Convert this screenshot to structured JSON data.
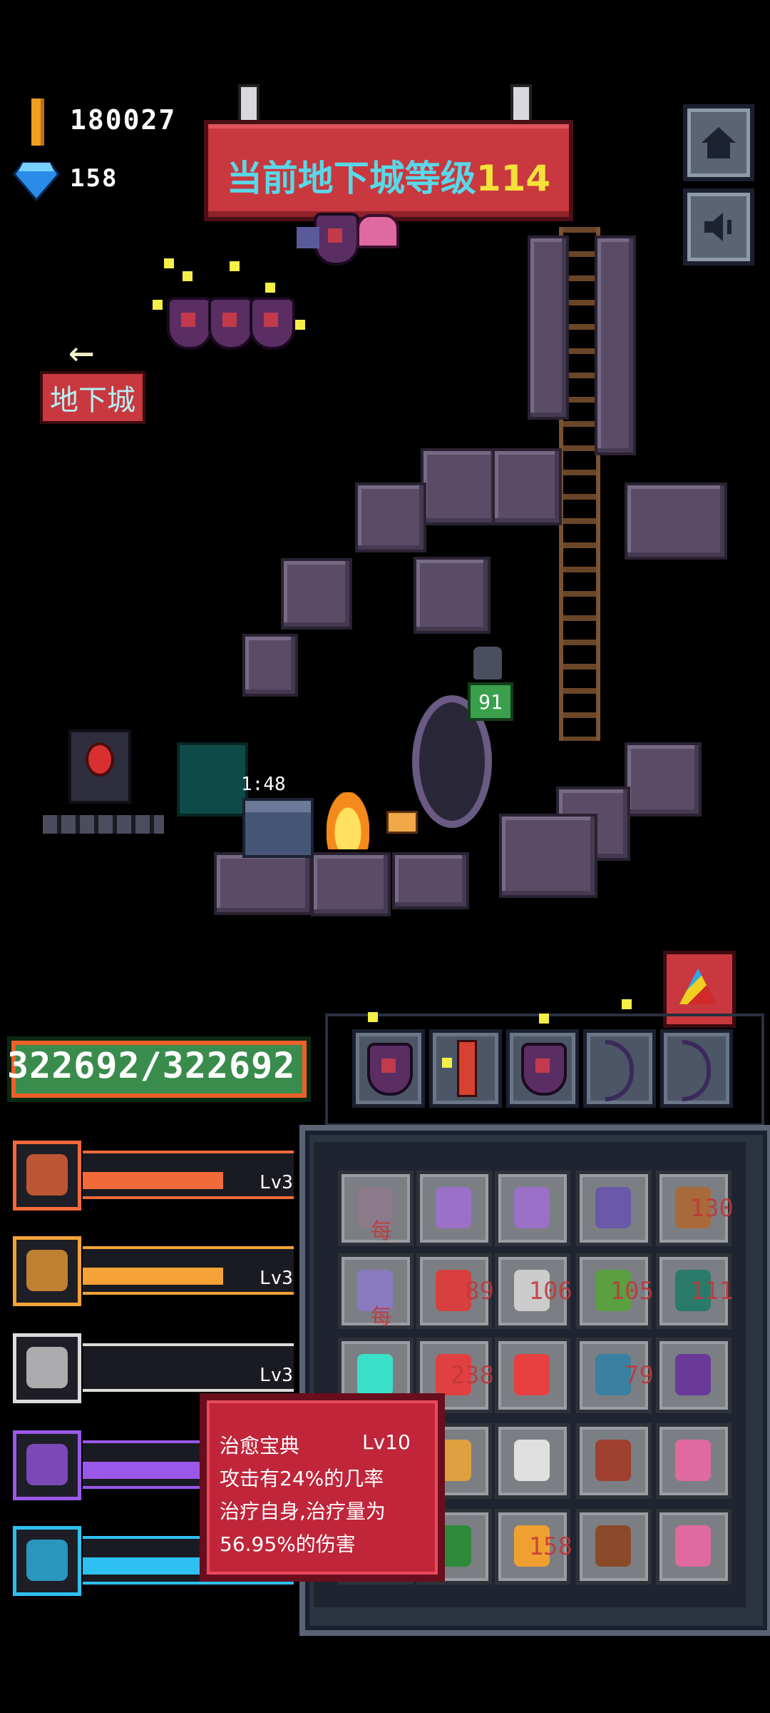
{
  "currency": {
    "gold": "180027",
    "gems": "158"
  },
  "banner": {
    "label": "当前地下城等级",
    "level": "114"
  },
  "nav": {
    "back_arrow": "←",
    "dungeon_label": "地下城",
    "home_icon": "house-icon",
    "sound_icon": "speaker-icon"
  },
  "scene": {
    "timer": "1:48",
    "npc_level": "91"
  },
  "hero": {
    "hp": "322692/322692"
  },
  "skills": [
    {
      "name": "helmet",
      "level": "Lv3",
      "fill": 0.82,
      "color": "#f26a3a"
    },
    {
      "name": "crossed-swords",
      "level": "Lv3",
      "fill": 0.82,
      "color": "#f5a236"
    },
    {
      "name": "boot",
      "level": "Lv3",
      "fill": 0.0,
      "color": "#dcdcdc"
    },
    {
      "name": "wand",
      "level": "",
      "fill": 0.75,
      "color": "#9a58e8"
    },
    {
      "name": "bow-arrows",
      "level": "",
      "fill": 0.75,
      "color": "#2ec0f0"
    }
  ],
  "inventory": {
    "counts": {
      "r0c4": "130",
      "r1c1": "89",
      "r1c2": "106",
      "r1c3": "105",
      "r1c4": "111",
      "r2c1": "238",
      "r2c3": "79",
      "r4c2": "158"
    },
    "faint_label": "每"
  },
  "tooltip": {
    "title": "治愈宝典",
    "level": "Lv10",
    "line1": "攻击有24%的几率",
    "line2": "治疗自身,治疗量为",
    "line3": "56.95%的伤害"
  },
  "colors": {
    "banner": "#c8383e",
    "banner_text": "#59d8e8",
    "banner_level": "#f4e23a",
    "hp": "#3a8c4c",
    "tooltip": "#c0253a"
  }
}
